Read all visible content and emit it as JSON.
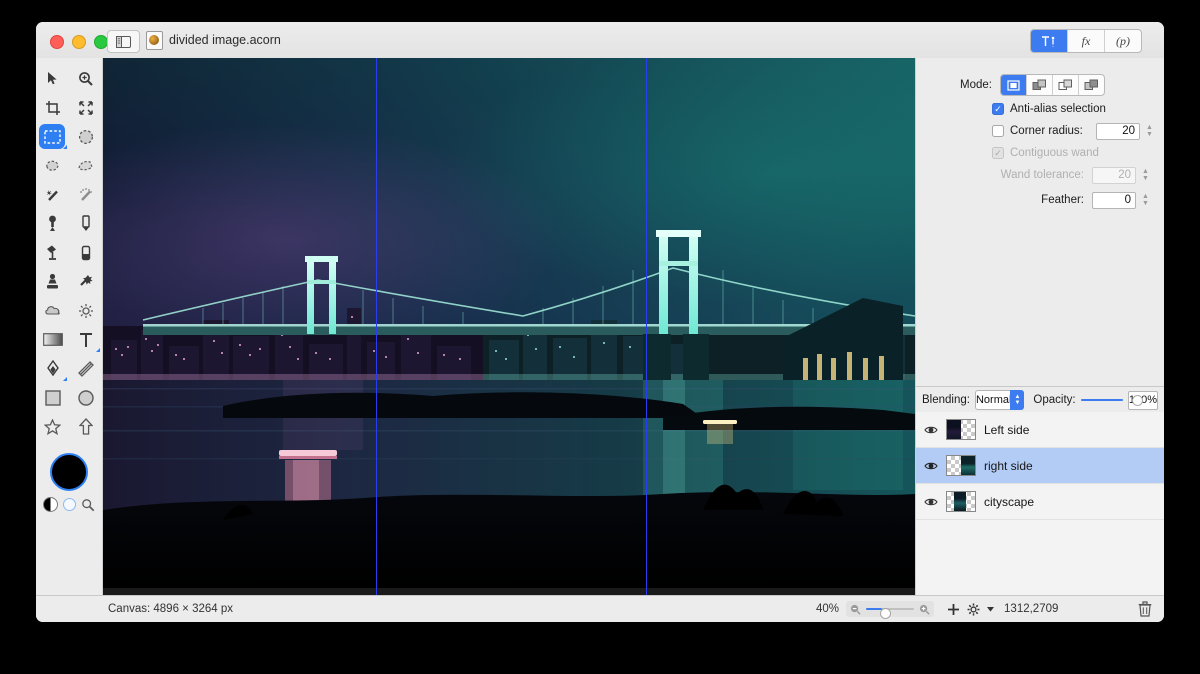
{
  "app": {
    "document_title": "divided image.acorn",
    "doc_icon": "acorn-document-icon",
    "sidebar_toggle_icon": "sidebar-toggle-icon"
  },
  "window_controls": {
    "close": "close-button",
    "minimize": "minimize-button",
    "zoom": "zoom-button"
  },
  "inspector_tabs": [
    {
      "label": "T",
      "name": "tool-options-tab",
      "active": true
    },
    {
      "label": "fx",
      "name": "filters-tab",
      "active": false
    },
    {
      "label": "(p)",
      "name": "palette-tab",
      "active": false
    }
  ],
  "tools": [
    {
      "name": "move-tool",
      "glyph": "➤"
    },
    {
      "name": "zoom-tool",
      "glyph": "⌕"
    },
    {
      "name": "crop-tool",
      "glyph": "⌧"
    },
    {
      "name": "transform-tool",
      "glyph": "⤡"
    },
    {
      "name": "rectangle-select-tool",
      "glyph": "▣",
      "active": true
    },
    {
      "name": "ellipse-select-tool",
      "glyph": "●"
    },
    {
      "name": "lasso-tool",
      "glyph": "☁"
    },
    {
      "name": "polygon-lasso-tool",
      "glyph": "◠"
    },
    {
      "name": "magic-wand-tool",
      "glyph": "✦"
    },
    {
      "name": "similar-wand-tool",
      "glyph": "❁"
    },
    {
      "name": "eyedropper-tool",
      "glyph": "⚲"
    },
    {
      "name": "pencil-tool",
      "glyph": "✎"
    },
    {
      "name": "paint-bucket-tool",
      "glyph": "⬟"
    },
    {
      "name": "eraser-tool",
      "glyph": "▮"
    },
    {
      "name": "clone-stamp-tool",
      "glyph": "⛁"
    },
    {
      "name": "smudge-tool",
      "glyph": "❉"
    },
    {
      "name": "blur-tool",
      "glyph": "☁"
    },
    {
      "name": "dodge-tool",
      "glyph": "☀"
    },
    {
      "name": "gradient-tool",
      "glyph": "▭"
    },
    {
      "name": "text-tool",
      "glyph": "T"
    },
    {
      "name": "pen-tool",
      "glyph": "✒"
    },
    {
      "name": "line-tool",
      "glyph": "╱"
    },
    {
      "name": "rectangle-shape-tool",
      "glyph": "□"
    },
    {
      "name": "ellipse-shape-tool",
      "glyph": "○"
    },
    {
      "name": "star-shape-tool",
      "glyph": "☆"
    },
    {
      "name": "arrow-shape-tool",
      "glyph": "⇧"
    }
  ],
  "color_swatch": {
    "foreground": "#000000",
    "ring": "#2d7ff2",
    "half_circle_icon": "color-mode-icon",
    "mini_circle_icon": "background-swatch-icon",
    "loupe_icon": "magnifier-icon"
  },
  "tool_options": {
    "mode_label": "Mode:",
    "modes": [
      {
        "name": "mode-new-selection",
        "active": true
      },
      {
        "name": "mode-add-selection",
        "active": false
      },
      {
        "name": "mode-subtract-selection",
        "active": false
      },
      {
        "name": "mode-intersect-selection",
        "active": false
      }
    ],
    "antialias": {
      "label": "Anti-alias selection",
      "checked": true,
      "disabled": false
    },
    "corner_radius": {
      "label": "Corner radius:",
      "checked": false,
      "value": "20",
      "disabled": false
    },
    "contiguous_wand": {
      "label": "Contiguous wand",
      "checked": true,
      "disabled": true
    },
    "wand_tolerance": {
      "label": "Wand tolerance:",
      "value": "20",
      "disabled": true
    },
    "feather": {
      "label": "Feather:",
      "value": "0",
      "disabled": false
    }
  },
  "layers_panel": {
    "blending_label": "Blending:",
    "blending_value": "Normal",
    "opacity_label": "Opacity:",
    "opacity_value": "100%",
    "opacity_percent": 100,
    "layers": [
      {
        "name": "Left side",
        "visible": true,
        "selected": false,
        "thumb_side": "left"
      },
      {
        "name": "right side",
        "visible": true,
        "selected": true,
        "thumb_side": "right"
      },
      {
        "name": "cityscape",
        "visible": true,
        "selected": false,
        "thumb_side": "center"
      }
    ]
  },
  "status_bar": {
    "canvas_label": "Canvas: 4896 × 3264 px",
    "zoom_level": "40%",
    "coordinates": "1312,2709",
    "add_layer_icon": "plus-icon",
    "actions_icon": "gear-icon",
    "delete_icon": "trash-icon",
    "zoom_out_icon": "zoom-out-icon",
    "zoom_in_icon": "zoom-in-icon"
  },
  "canvas": {
    "image_name": "tokyo-rainbow-bridge-night",
    "guides": [
      {
        "name": "vertical-guide-left",
        "x_percent": 33.6
      },
      {
        "name": "vertical-guide-right",
        "x_percent": 67.0
      }
    ]
  }
}
